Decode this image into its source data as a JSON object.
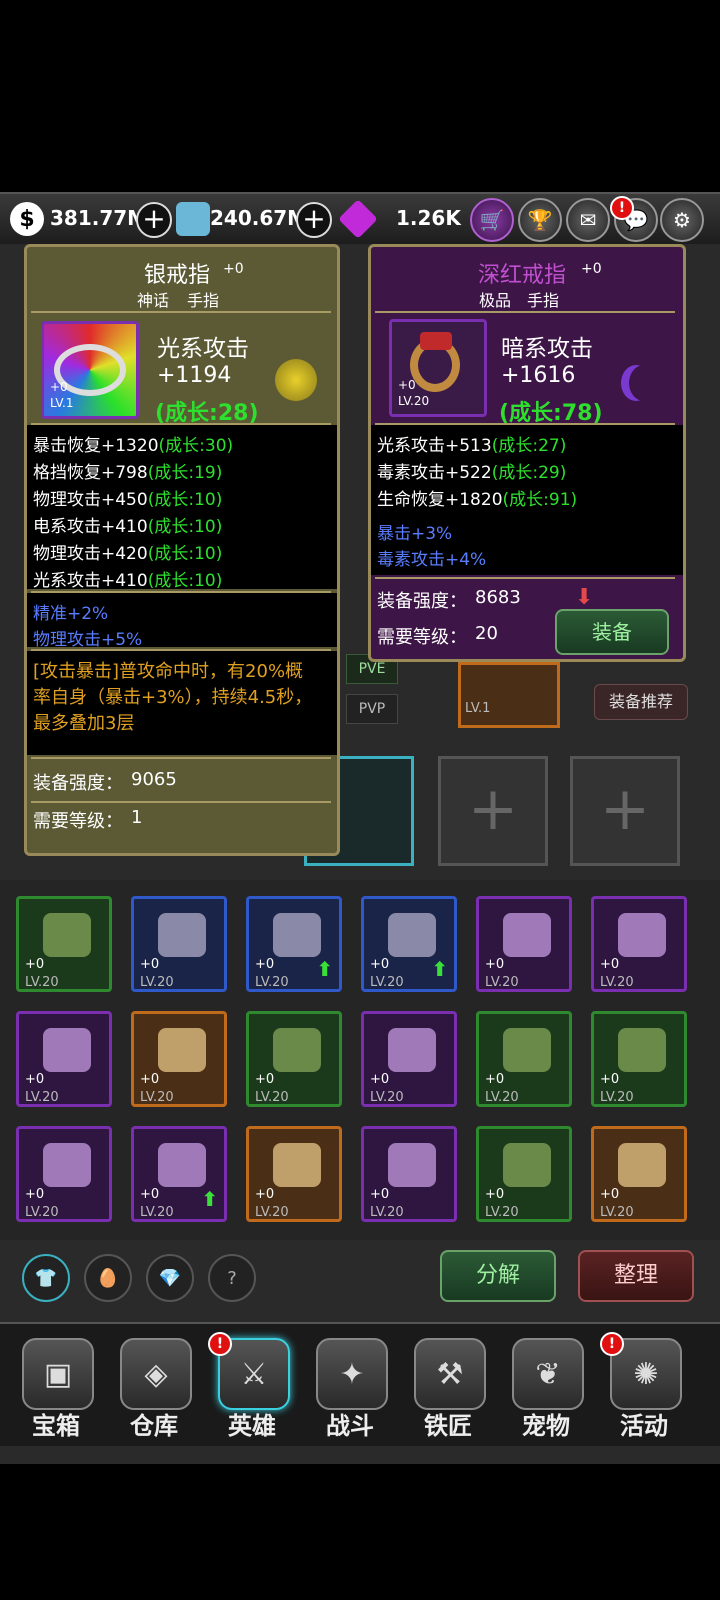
{
  "resources": {
    "gold": "381.77M",
    "diamond": "240.67M",
    "gem": "1.26K"
  },
  "top_buttons": [
    "cart-icon",
    "trophy-icon",
    "mail-icon",
    "chat-icon",
    "gear-icon"
  ],
  "left_item": {
    "name": "银戒指",
    "plus": "+0",
    "rarity": "神话",
    "slot": "手指",
    "plus_badge": "+0",
    "level": "LV.1",
    "main_stat": "光系攻击",
    "main_value": "+1194",
    "main_growth": "(成长:28)",
    "stats": [
      {
        "text": "暴击恢复+1320",
        "growth": "(成长:30)"
      },
      {
        "text": "格挡恢复+798",
        "growth": "(成长:19)"
      },
      {
        "text": "物理攻击+450",
        "growth": "(成长:10)"
      },
      {
        "text": "电系攻击+410",
        "growth": "(成长:10)"
      },
      {
        "text": "物理攻击+420",
        "growth": "(成长:10)"
      },
      {
        "text": "光系攻击+410",
        "growth": "(成长:10)"
      }
    ],
    "bonus": [
      "精准+2%",
      "物理攻击+5%"
    ],
    "skill_lines": [
      "[攻击暴击]普攻命中时，有20%概",
      "率自身（暴击+3%），持续4.5秒，",
      "最多叠加3层"
    ],
    "strength_label": "装备强度：",
    "strength": "9065",
    "req_label": "需要等级：",
    "req": "1"
  },
  "right_item": {
    "name": "深红戒指",
    "plus": "+0",
    "rarity": "极品",
    "slot": "手指",
    "plus_badge": "+0",
    "level": "LV.20",
    "main_stat": "暗系攻击",
    "main_value": "+1616",
    "main_growth": "(成长:78)",
    "stats": [
      {
        "text": "光系攻击+513",
        "growth": "(成长:27)"
      },
      {
        "text": "毒素攻击+522",
        "growth": "(成长:29)"
      },
      {
        "text": "生命恢复+1820",
        "growth": "(成长:91)"
      }
    ],
    "bonus": [
      "暴击+3%",
      "毒素攻击+4%"
    ],
    "strength_label": "装备强度：",
    "strength": "8683",
    "req_label": "需要等级：",
    "req": "20",
    "equip_button": "装备"
  },
  "behind": {
    "pve": "PVE",
    "pvp": "PVP",
    "recommend": "装备推荐",
    "lv_partial": "LV.1",
    "lv20_partial": "LV.20"
  },
  "inventory": [
    {
      "plus": "+0",
      "level": "LV.20",
      "rarity": "green",
      "icon": "bow-icon"
    },
    {
      "plus": "+0",
      "level": "LV.20",
      "rarity": "blue",
      "icon": "gloves-icon"
    },
    {
      "plus": "+0",
      "level": "LV.20",
      "rarity": "blue",
      "icon": "boots-icon",
      "upgrade": true
    },
    {
      "plus": "+0",
      "level": "LV.20",
      "rarity": "blue",
      "icon": "boots-icon",
      "upgrade": true
    },
    {
      "plus": "+0",
      "level": "LV.20",
      "rarity": "purple",
      "icon": "ring-icon"
    },
    {
      "plus": "+0",
      "level": "LV.20",
      "rarity": "purple",
      "icon": "helmet-icon"
    },
    {
      "plus": "+0",
      "level": "LV.20",
      "rarity": "purple",
      "icon": "armor-icon"
    },
    {
      "plus": "+0",
      "level": "LV.20",
      "rarity": "orange",
      "icon": "helmet-icon"
    },
    {
      "plus": "+0",
      "level": "LV.20",
      "rarity": "green",
      "icon": "hood-icon"
    },
    {
      "plus": "+0",
      "level": "LV.20",
      "rarity": "purple",
      "icon": "knight-armor-icon"
    },
    {
      "plus": "+0",
      "level": "LV.20",
      "rarity": "green",
      "icon": "chest-armor-icon"
    },
    {
      "plus": "+0",
      "level": "LV.20",
      "rarity": "green",
      "icon": "staff-icon"
    },
    {
      "plus": "+0",
      "level": "LV.20",
      "rarity": "purple",
      "icon": "gloves-icon"
    },
    {
      "plus": "+0",
      "level": "LV.20",
      "rarity": "purple",
      "icon": "shuriken-icon",
      "upgrade": true
    },
    {
      "plus": "+0",
      "level": "LV.20",
      "rarity": "orange",
      "icon": "hood-icon"
    },
    {
      "plus": "+0",
      "level": "LV.20",
      "rarity": "purple",
      "icon": "ring-icon"
    },
    {
      "plus": "+0",
      "level": "LV.20",
      "rarity": "green",
      "icon": "hat-icon"
    },
    {
      "plus": "+0",
      "level": "LV.20",
      "rarity": "orange",
      "icon": "gauntlet-icon"
    }
  ],
  "filters": [
    "armor-filter-icon",
    "egg-filter-icon",
    "gem-filter-icon",
    "unknown-filter-icon"
  ],
  "filter_unknown": "?",
  "actions": {
    "decompose": "分解",
    "sort": "整理"
  },
  "nav": [
    {
      "label": "宝箱",
      "icon": "chest-icon",
      "badge": false
    },
    {
      "label": "仓库",
      "icon": "backpack-icon",
      "badge": false
    },
    {
      "label": "英雄",
      "icon": "hero-icon",
      "badge": true,
      "active": true
    },
    {
      "label": "战斗",
      "icon": "battle-icon",
      "badge": false
    },
    {
      "label": "铁匠",
      "icon": "anvil-icon",
      "badge": false
    },
    {
      "label": "宠物",
      "icon": "pet-icon",
      "badge": false
    },
    {
      "label": "活动",
      "icon": "event-icon",
      "badge": true
    }
  ],
  "badge_mark": "!"
}
